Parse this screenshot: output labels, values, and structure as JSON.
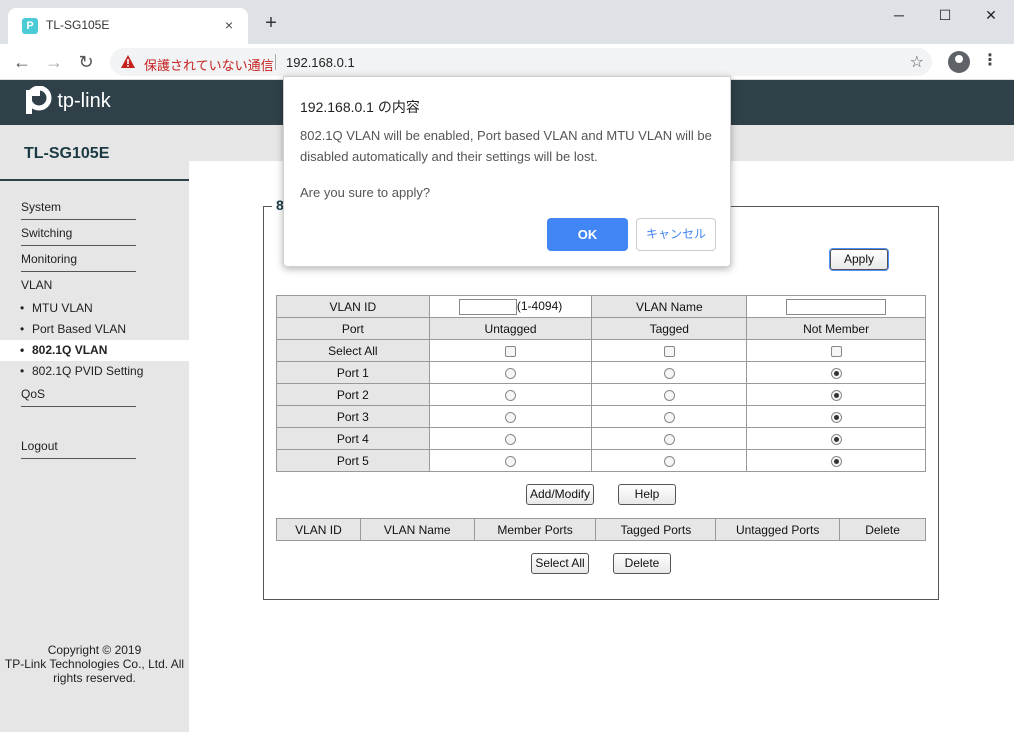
{
  "browser": {
    "tab_title": "TL-SG105E",
    "tab_favicon": "P",
    "tab_close": "×",
    "new_tab": "+",
    "insecure_label": "保護されていない通信",
    "url": "192.168.0.1",
    "window_controls": {
      "minimize": "─",
      "maximize": "☐",
      "close": "✕"
    },
    "nav": {
      "back": "←",
      "forward": "→",
      "reload": "↻"
    },
    "star": "☆",
    "menu": "⋮"
  },
  "header": {
    "brand": "tp-link",
    "device_name": "TL-SG105E"
  },
  "sidebar": {
    "items": [
      {
        "label": "System"
      },
      {
        "label": "Switching"
      },
      {
        "label": "Monitoring"
      },
      {
        "label": "VLAN"
      }
    ],
    "vlan_sub": [
      {
        "label": "MTU VLAN"
      },
      {
        "label": "Port Based VLAN"
      },
      {
        "label": "802.1Q VLAN",
        "active": true
      },
      {
        "label": "802.1Q PVID Setting"
      }
    ],
    "qos": "QoS",
    "logout": "Logout",
    "bullet": "•",
    "copyright_lines": [
      "Copyright © 2019",
      "TP-Link Technologies Co., Ltd. All",
      "rights reserved."
    ]
  },
  "panel": {
    "title_fragment": "8",
    "apply_label": "Apply",
    "vlan_id_label": "VLAN ID",
    "vlan_id_range": "(1-4094)",
    "vlan_name_label": "VLAN Name",
    "port_header": "Port",
    "untagged_header": "Untagged",
    "tagged_header": "Tagged",
    "not_member_header": "Not Member",
    "select_all_label": "Select All",
    "ports": [
      {
        "name": "Port 1",
        "selected": "not_member"
      },
      {
        "name": "Port 2",
        "selected": "not_member"
      },
      {
        "name": "Port 3",
        "selected": "not_member"
      },
      {
        "name": "Port 4",
        "selected": "not_member"
      },
      {
        "name": "Port 5",
        "selected": "not_member"
      }
    ],
    "add_modify_label": "Add/Modify",
    "help_label": "Help",
    "list_headers": [
      "VLAN ID",
      "VLAN Name",
      "Member Ports",
      "Tagged Ports",
      "Untagged Ports",
      "Delete"
    ],
    "select_all_button": "Select All",
    "delete_button": "Delete"
  },
  "dialog": {
    "title": "192.168.0.1 の内容",
    "message": "802.1Q VLAN will be enabled, Port based VLAN and MTU VLAN will be disabled automatically and their settings will be lost.",
    "question": "Are you sure to apply?",
    "ok_label": "OK",
    "cancel_label": "キャンセル"
  },
  "colors": {
    "banner": "#2f4049",
    "accent": "#4285f4",
    "insecure": "#c5221f"
  }
}
